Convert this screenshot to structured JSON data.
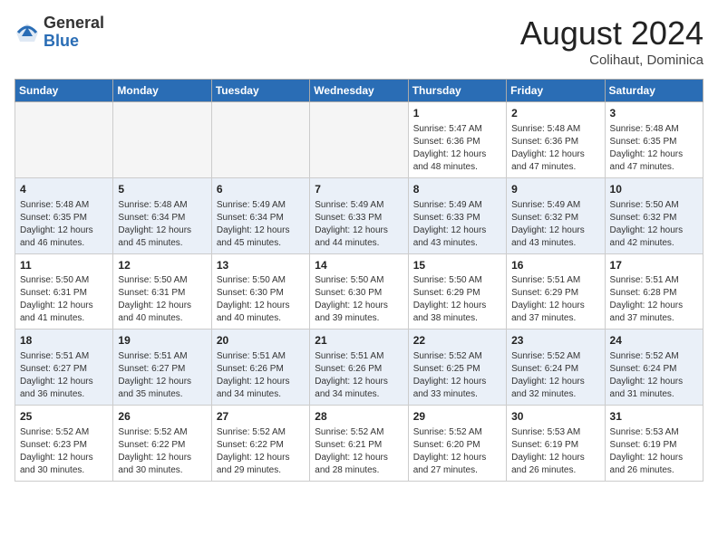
{
  "header": {
    "logo_general": "General",
    "logo_blue": "Blue",
    "title": "August 2024",
    "location": "Colihaut, Dominica"
  },
  "days_of_week": [
    "Sunday",
    "Monday",
    "Tuesday",
    "Wednesday",
    "Thursday",
    "Friday",
    "Saturday"
  ],
  "weeks": [
    {
      "row_class": "row-even",
      "days": [
        {
          "num": "",
          "info": "",
          "empty": true
        },
        {
          "num": "",
          "info": "",
          "empty": true
        },
        {
          "num": "",
          "info": "",
          "empty": true
        },
        {
          "num": "",
          "info": "",
          "empty": true
        },
        {
          "num": "1",
          "info": "Sunrise: 5:47 AM\nSunset: 6:36 PM\nDaylight: 12 hours\nand 48 minutes.",
          "empty": false
        },
        {
          "num": "2",
          "info": "Sunrise: 5:48 AM\nSunset: 6:36 PM\nDaylight: 12 hours\nand 47 minutes.",
          "empty": false
        },
        {
          "num": "3",
          "info": "Sunrise: 5:48 AM\nSunset: 6:35 PM\nDaylight: 12 hours\nand 47 minutes.",
          "empty": false
        }
      ]
    },
    {
      "row_class": "row-odd",
      "days": [
        {
          "num": "4",
          "info": "Sunrise: 5:48 AM\nSunset: 6:35 PM\nDaylight: 12 hours\nand 46 minutes.",
          "empty": false
        },
        {
          "num": "5",
          "info": "Sunrise: 5:48 AM\nSunset: 6:34 PM\nDaylight: 12 hours\nand 45 minutes.",
          "empty": false
        },
        {
          "num": "6",
          "info": "Sunrise: 5:49 AM\nSunset: 6:34 PM\nDaylight: 12 hours\nand 45 minutes.",
          "empty": false
        },
        {
          "num": "7",
          "info": "Sunrise: 5:49 AM\nSunset: 6:33 PM\nDaylight: 12 hours\nand 44 minutes.",
          "empty": false
        },
        {
          "num": "8",
          "info": "Sunrise: 5:49 AM\nSunset: 6:33 PM\nDaylight: 12 hours\nand 43 minutes.",
          "empty": false
        },
        {
          "num": "9",
          "info": "Sunrise: 5:49 AM\nSunset: 6:32 PM\nDaylight: 12 hours\nand 43 minutes.",
          "empty": false
        },
        {
          "num": "10",
          "info": "Sunrise: 5:50 AM\nSunset: 6:32 PM\nDaylight: 12 hours\nand 42 minutes.",
          "empty": false
        }
      ]
    },
    {
      "row_class": "row-even",
      "days": [
        {
          "num": "11",
          "info": "Sunrise: 5:50 AM\nSunset: 6:31 PM\nDaylight: 12 hours\nand 41 minutes.",
          "empty": false
        },
        {
          "num": "12",
          "info": "Sunrise: 5:50 AM\nSunset: 6:31 PM\nDaylight: 12 hours\nand 40 minutes.",
          "empty": false
        },
        {
          "num": "13",
          "info": "Sunrise: 5:50 AM\nSunset: 6:30 PM\nDaylight: 12 hours\nand 40 minutes.",
          "empty": false
        },
        {
          "num": "14",
          "info": "Sunrise: 5:50 AM\nSunset: 6:30 PM\nDaylight: 12 hours\nand 39 minutes.",
          "empty": false
        },
        {
          "num": "15",
          "info": "Sunrise: 5:50 AM\nSunset: 6:29 PM\nDaylight: 12 hours\nand 38 minutes.",
          "empty": false
        },
        {
          "num": "16",
          "info": "Sunrise: 5:51 AM\nSunset: 6:29 PM\nDaylight: 12 hours\nand 37 minutes.",
          "empty": false
        },
        {
          "num": "17",
          "info": "Sunrise: 5:51 AM\nSunset: 6:28 PM\nDaylight: 12 hours\nand 37 minutes.",
          "empty": false
        }
      ]
    },
    {
      "row_class": "row-odd",
      "days": [
        {
          "num": "18",
          "info": "Sunrise: 5:51 AM\nSunset: 6:27 PM\nDaylight: 12 hours\nand 36 minutes.",
          "empty": false
        },
        {
          "num": "19",
          "info": "Sunrise: 5:51 AM\nSunset: 6:27 PM\nDaylight: 12 hours\nand 35 minutes.",
          "empty": false
        },
        {
          "num": "20",
          "info": "Sunrise: 5:51 AM\nSunset: 6:26 PM\nDaylight: 12 hours\nand 34 minutes.",
          "empty": false
        },
        {
          "num": "21",
          "info": "Sunrise: 5:51 AM\nSunset: 6:26 PM\nDaylight: 12 hours\nand 34 minutes.",
          "empty": false
        },
        {
          "num": "22",
          "info": "Sunrise: 5:52 AM\nSunset: 6:25 PM\nDaylight: 12 hours\nand 33 minutes.",
          "empty": false
        },
        {
          "num": "23",
          "info": "Sunrise: 5:52 AM\nSunset: 6:24 PM\nDaylight: 12 hours\nand 32 minutes.",
          "empty": false
        },
        {
          "num": "24",
          "info": "Sunrise: 5:52 AM\nSunset: 6:24 PM\nDaylight: 12 hours\nand 31 minutes.",
          "empty": false
        }
      ]
    },
    {
      "row_class": "row-even",
      "days": [
        {
          "num": "25",
          "info": "Sunrise: 5:52 AM\nSunset: 6:23 PM\nDaylight: 12 hours\nand 30 minutes.",
          "empty": false
        },
        {
          "num": "26",
          "info": "Sunrise: 5:52 AM\nSunset: 6:22 PM\nDaylight: 12 hours\nand 30 minutes.",
          "empty": false
        },
        {
          "num": "27",
          "info": "Sunrise: 5:52 AM\nSunset: 6:22 PM\nDaylight: 12 hours\nand 29 minutes.",
          "empty": false
        },
        {
          "num": "28",
          "info": "Sunrise: 5:52 AM\nSunset: 6:21 PM\nDaylight: 12 hours\nand 28 minutes.",
          "empty": false
        },
        {
          "num": "29",
          "info": "Sunrise: 5:52 AM\nSunset: 6:20 PM\nDaylight: 12 hours\nand 27 minutes.",
          "empty": false
        },
        {
          "num": "30",
          "info": "Sunrise: 5:53 AM\nSunset: 6:19 PM\nDaylight: 12 hours\nand 26 minutes.",
          "empty": false
        },
        {
          "num": "31",
          "info": "Sunrise: 5:53 AM\nSunset: 6:19 PM\nDaylight: 12 hours\nand 26 minutes.",
          "empty": false
        }
      ]
    }
  ]
}
